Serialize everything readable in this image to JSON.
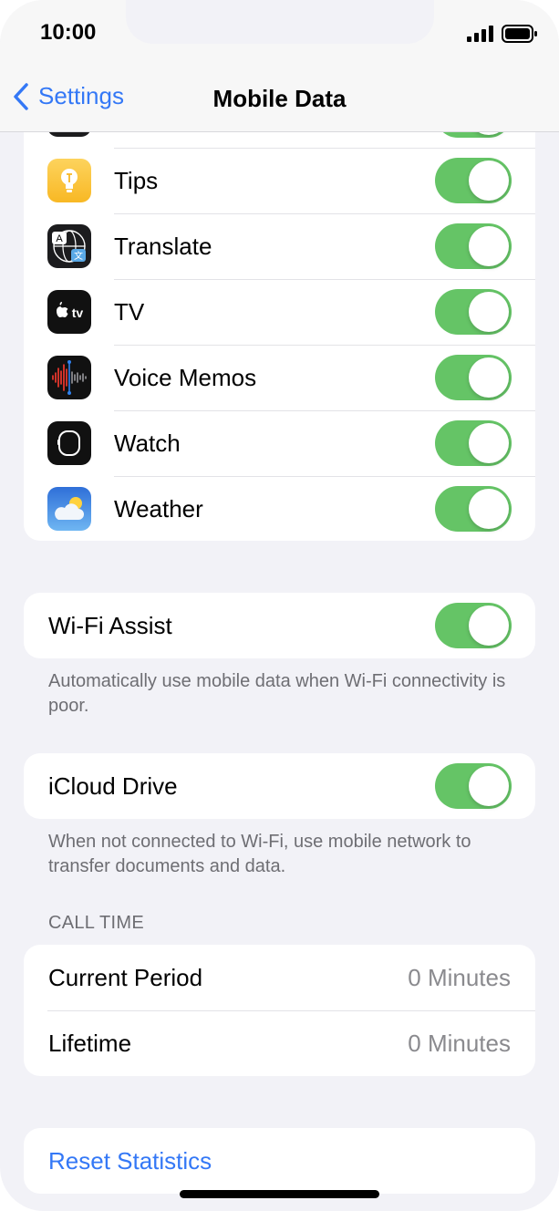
{
  "status_bar": {
    "time": "10:00"
  },
  "nav": {
    "back_label": "Settings",
    "title": "Mobile Data"
  },
  "apps": [
    {
      "label": "Tips",
      "icon": "tips-icon",
      "enabled": true
    },
    {
      "label": "Translate",
      "icon": "translate-icon",
      "enabled": true
    },
    {
      "label": "TV",
      "icon": "tv-icon",
      "enabled": true
    },
    {
      "label": "Voice Memos",
      "icon": "voice-memos-icon",
      "enabled": true
    },
    {
      "label": "Watch",
      "icon": "watch-icon",
      "enabled": true
    },
    {
      "label": "Weather",
      "icon": "weather-icon",
      "enabled": true
    }
  ],
  "wifi_assist": {
    "label": "Wi-Fi Assist",
    "enabled": true,
    "footnote": "Automatically use mobile data when Wi-Fi connectivity is poor."
  },
  "icloud_drive": {
    "label": "iCloud Drive",
    "enabled": true,
    "footnote": "When not connected to Wi-Fi, use mobile network to transfer documents and data."
  },
  "call_time": {
    "header": "CALL TIME",
    "rows": [
      {
        "label": "Current Period",
        "value": "0 Minutes"
      },
      {
        "label": "Lifetime",
        "value": "0 Minutes"
      }
    ]
  },
  "reset_label": "Reset Statistics",
  "colors": {
    "accent": "#3478f6",
    "toggle_on": "#65c466",
    "background": "#f2f2f7"
  }
}
